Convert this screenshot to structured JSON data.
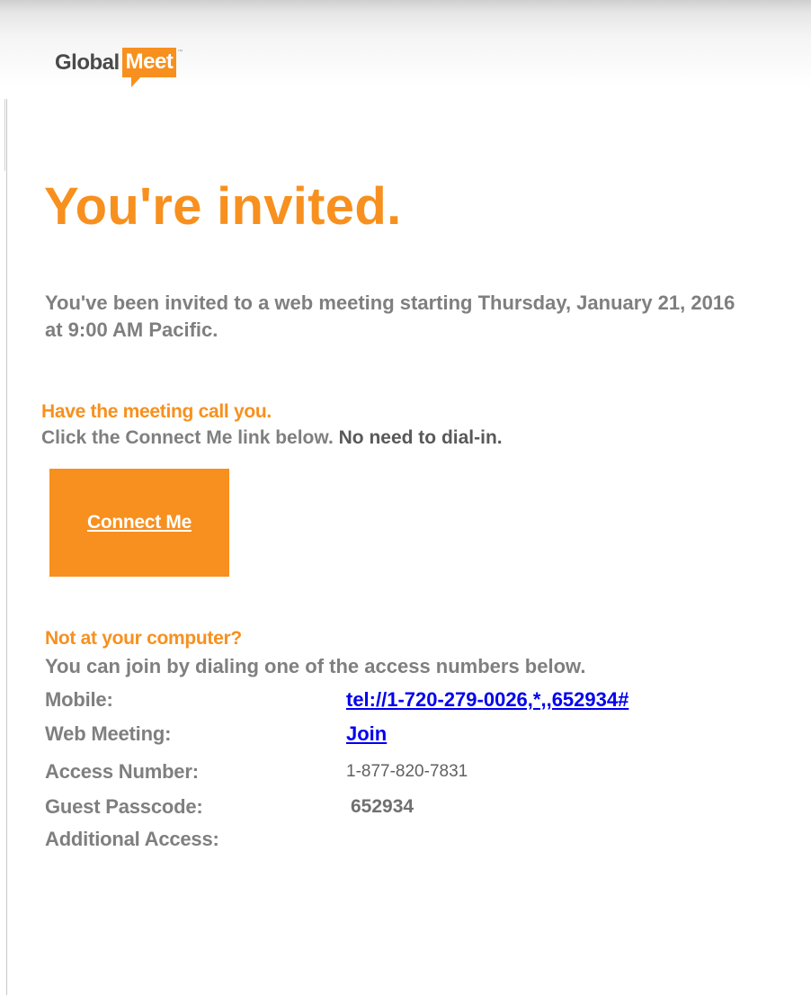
{
  "logo": {
    "global": "Global",
    "meet": "Meet",
    "tm": "™"
  },
  "title": "You're invited.",
  "intro": "You've been invited to a web meeting starting Thursday, January 21, 2016 at 9:00 AM Pacific.",
  "call": {
    "heading": "Have the meeting call you.",
    "body_prefix": "Click the Connect Me link below.",
    "body_strong": "No need to dial-in.",
    "button_label": "Connect Me"
  },
  "dial": {
    "heading": "Not at your computer?",
    "body": "You can join by dialing one of the access numbers below.",
    "rows": [
      {
        "label": "Mobile:",
        "value": "tel://1-720-279-0026,*,,652934#"
      },
      {
        "label": "Web Meeting:",
        "value": "Join"
      },
      {
        "label": "Access Number:",
        "value": "1-877-820-7831"
      },
      {
        "label": "Guest Passcode:",
        "value": "652934"
      },
      {
        "label": "Additional Access:",
        "value": ""
      }
    ]
  },
  "colors": {
    "brand_orange": "#f7901e",
    "text_gray": "#7f7f7f",
    "link_blue": "#0000ee"
  }
}
